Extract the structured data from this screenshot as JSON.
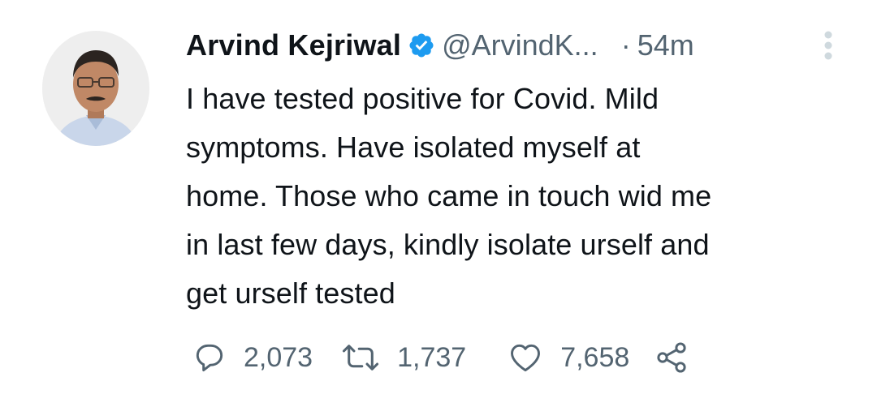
{
  "tweet": {
    "author_name": "Arvind Kejriwal",
    "handle": "@ArvindK...",
    "separator": "·",
    "time": "54m",
    "verified": true,
    "text_lines": [
      "I have tested positive for Covid. Mild",
      "symptoms. Have isolated myself at",
      "home. Those who came in touch wid me",
      "in last few days, kindly isolate urself and",
      "get urself tested"
    ],
    "stats": {
      "replies": "2,073",
      "retweets": "1,737",
      "likes": "7,658"
    }
  },
  "icons": {
    "verified": "verified-badge-icon",
    "more": "more-vertical-icon",
    "reply": "reply-icon",
    "retweet": "retweet-icon",
    "like": "heart-icon",
    "share": "share-icon"
  },
  "colors": {
    "text": "#0f1419",
    "secondary": "#536471",
    "verified_blue": "#1d9bf0",
    "more_dots": "#cfd9de"
  }
}
